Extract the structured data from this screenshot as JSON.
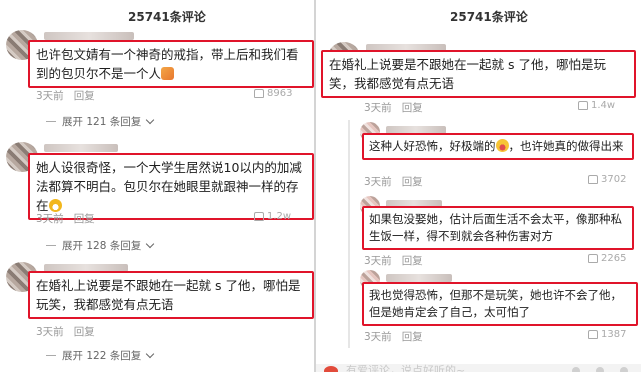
{
  "left": {
    "comment_count": "25741条评论",
    "comments": [
      {
        "text": "也许包文婧有一个神奇的戒指，带上后和我们看到的包贝尔不是一个人",
        "time": "3天前",
        "reply": "回复",
        "likes": "8963",
        "expand": "展开 121 条回复",
        "emoji": "cat"
      },
      {
        "text": "她人设很奇怪，一个大学生居然说10以内的加减法都算不明白。包贝尔在她眼里就跟神一样的存在",
        "time": "3天前",
        "reply": "回复",
        "likes": "1.2w",
        "expand": "展开 128 条回复",
        "emoji": "grin"
      },
      {
        "text": "在婚礼上说要是不跟她在一起就 s 了他，哪怕是玩笑，我都感觉有点无语",
        "time": "3天前",
        "reply": "回复",
        "likes": "",
        "expand": "展开 122 条回复"
      }
    ]
  },
  "right": {
    "comment_count": "25741条评论",
    "main": {
      "text": "在婚礼上说要是不跟她在一起就 s 了他，哪怕是玩笑，我都感觉有点无语",
      "time": "3天前",
      "reply": "回复",
      "likes": "1.4w"
    },
    "replies": [
      {
        "text_a": "这种人好恐怖，好极端的",
        "emoji": "laugh",
        "text_b": "，也许她真的做得出来",
        "time": "3天前",
        "reply": "回复",
        "likes": "3702"
      },
      {
        "text": "如果包没娶她，估计后面生活不会太平，像那种私生饭一样，得不到就会各种伤害对方",
        "time": "3天前",
        "reply": "回复",
        "likes": "2265"
      },
      {
        "text": "我也觉得恐怖，但那不是玩笑，她也许不会了他，但是她肯定会了自己，太可怕了",
        "time": "3天前",
        "reply": "回复",
        "likes": "1387"
      }
    ],
    "bottom_input": "有爱评论，说点好听的~"
  }
}
